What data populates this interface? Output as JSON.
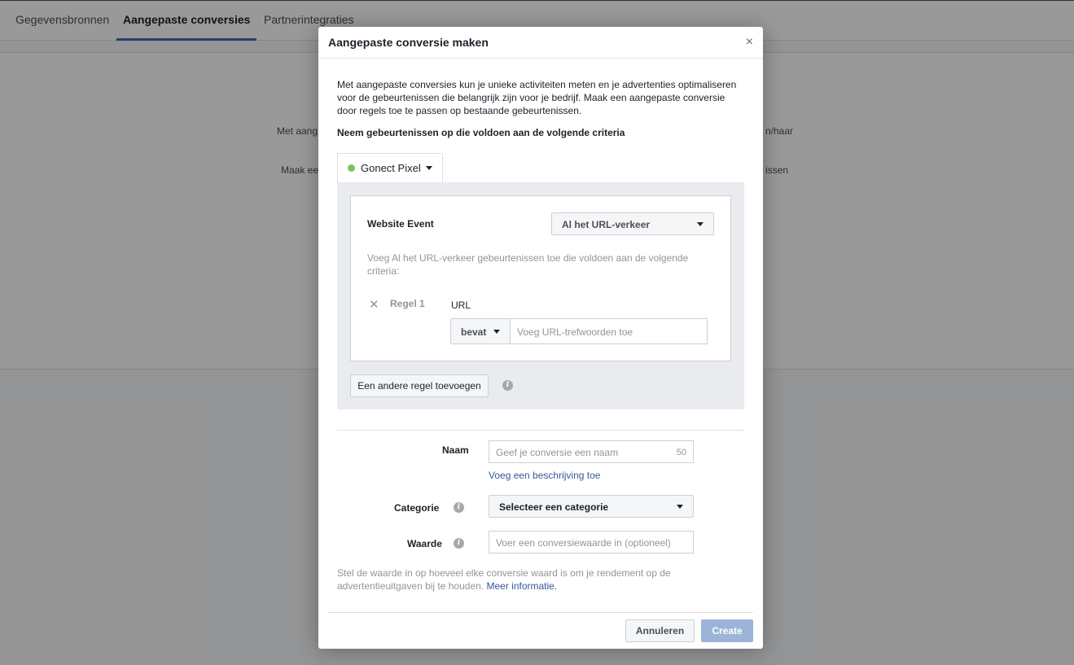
{
  "tabs": [
    {
      "label": "Gegevensbronnen",
      "active": false
    },
    {
      "label": "Aangepaste conversies",
      "active": true
    },
    {
      "label": "Partnerintegraties",
      "active": false
    }
  ],
  "background_fragments": {
    "left_1": "Met aang",
    "right_1": "n/haar",
    "left_2": "Maak ee",
    "right_2": "issen"
  },
  "dialog": {
    "title": "Aangepaste conversie maken",
    "close_glyph": "×",
    "intro": "Met aangepaste conversies kun je unieke activiteiten meten en je advertenties optimaliseren voor de gebeurtenissen die belangrijk zijn voor je bedrijf. Maak een aangepaste conversie door regels toe te passen op bestaande gebeurtenissen.",
    "criteria_heading": "Neem gebeurtenissen op die voldoen aan de volgende criteria",
    "pixel": {
      "label": "Gonect Pixel",
      "status_color": "#7bc35b"
    },
    "website_event": {
      "label": "Website Event",
      "selected": "Al het URL-verkeer",
      "description": "Voeg Al het URL-verkeer gebeurtenissen toe die voldoen aan de volgende criteria:"
    },
    "rule": {
      "remove_glyph": "✕",
      "label": "Regel 1",
      "field_label": "URL",
      "operator": "bevat",
      "placeholder": "Voeg URL-trefwoorden toe"
    },
    "add_rule_button": "Een andere regel toevoegen",
    "name": {
      "label": "Naam",
      "placeholder": "Geef je conversie een naam",
      "char_limit": "50",
      "add_description_link": "Voeg een beschrijving toe"
    },
    "category": {
      "label": "Categorie",
      "selected": "Selecteer een categorie"
    },
    "value": {
      "label": "Waarde",
      "placeholder": "Voer een conversiewaarde in (optioneel)"
    },
    "value_help": "Stel de waarde in op hoeveel elke conversie waard is om je rendement op de advertentieuitgaven bij te houden.",
    "more_info_link": "Meer informatie.",
    "cancel_button": "Annuleren",
    "create_button": "Create"
  },
  "colors": {
    "accent": "#4267b2",
    "primary_disabled": "#9cb4d8",
    "link": "#365899"
  }
}
